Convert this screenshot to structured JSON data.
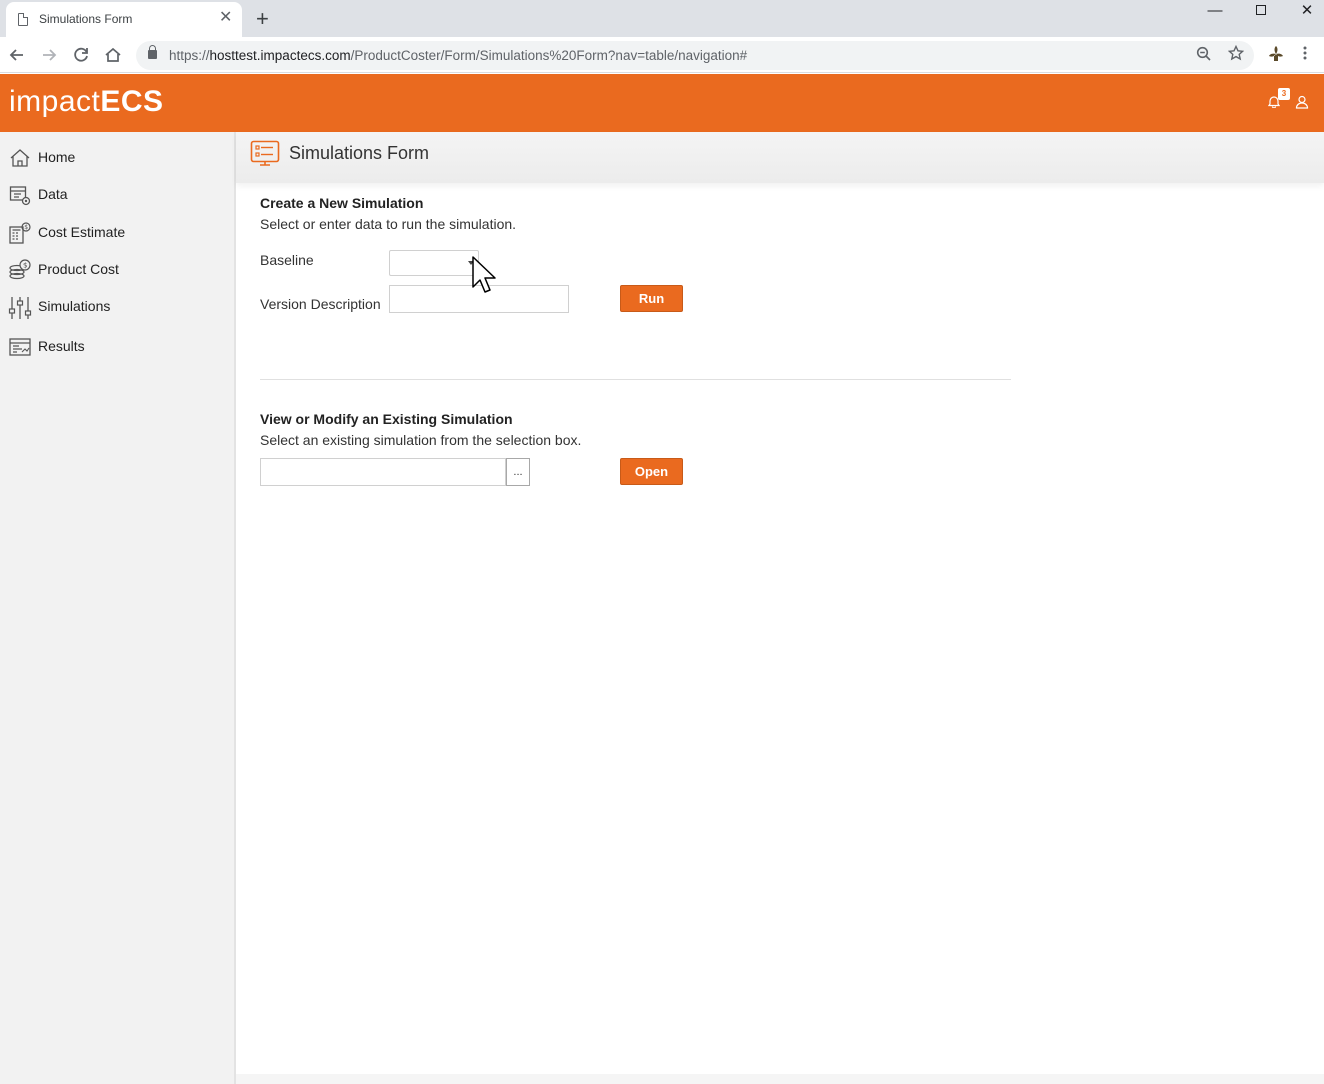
{
  "browser": {
    "tab_title": "Simulations Form",
    "tab_close": "✕",
    "new_tab": "+",
    "url_prefix": "https://",
    "url_host": "hosttest.impactecs.com",
    "url_path": "/ProductCoster/Form/Simulations%20Form?nav=table/navigation#",
    "window_minimize": "—",
    "window_close": "✕"
  },
  "app": {
    "logo_light": "impact",
    "logo_bold": "ECS",
    "notification_count": "3",
    "accent_color": "#ea6a1f"
  },
  "sidebar": {
    "items": [
      {
        "label": "Home",
        "icon": "home-icon"
      },
      {
        "label": "Data",
        "icon": "data-icon"
      },
      {
        "label": "Cost Estimate",
        "icon": "cost-estimate-icon"
      },
      {
        "label": "Product Cost",
        "icon": "product-cost-icon"
      },
      {
        "label": "Simulations",
        "icon": "simulations-icon"
      },
      {
        "label": "Results",
        "icon": "results-icon"
      }
    ]
  },
  "page": {
    "title": "Simulations Form"
  },
  "create_section": {
    "title": "Create a New Simulation",
    "description": "Select or enter data to run the simulation.",
    "baseline_label": "Baseline",
    "baseline_value": "",
    "version_label": "Version Description",
    "version_value": "",
    "run_label": "Run"
  },
  "existing_section": {
    "title": "View or Modify an Existing Simulation",
    "description": "Select an existing simulation from the selection box.",
    "selection_value": "",
    "lookup_label": "...",
    "open_label": "Open"
  }
}
